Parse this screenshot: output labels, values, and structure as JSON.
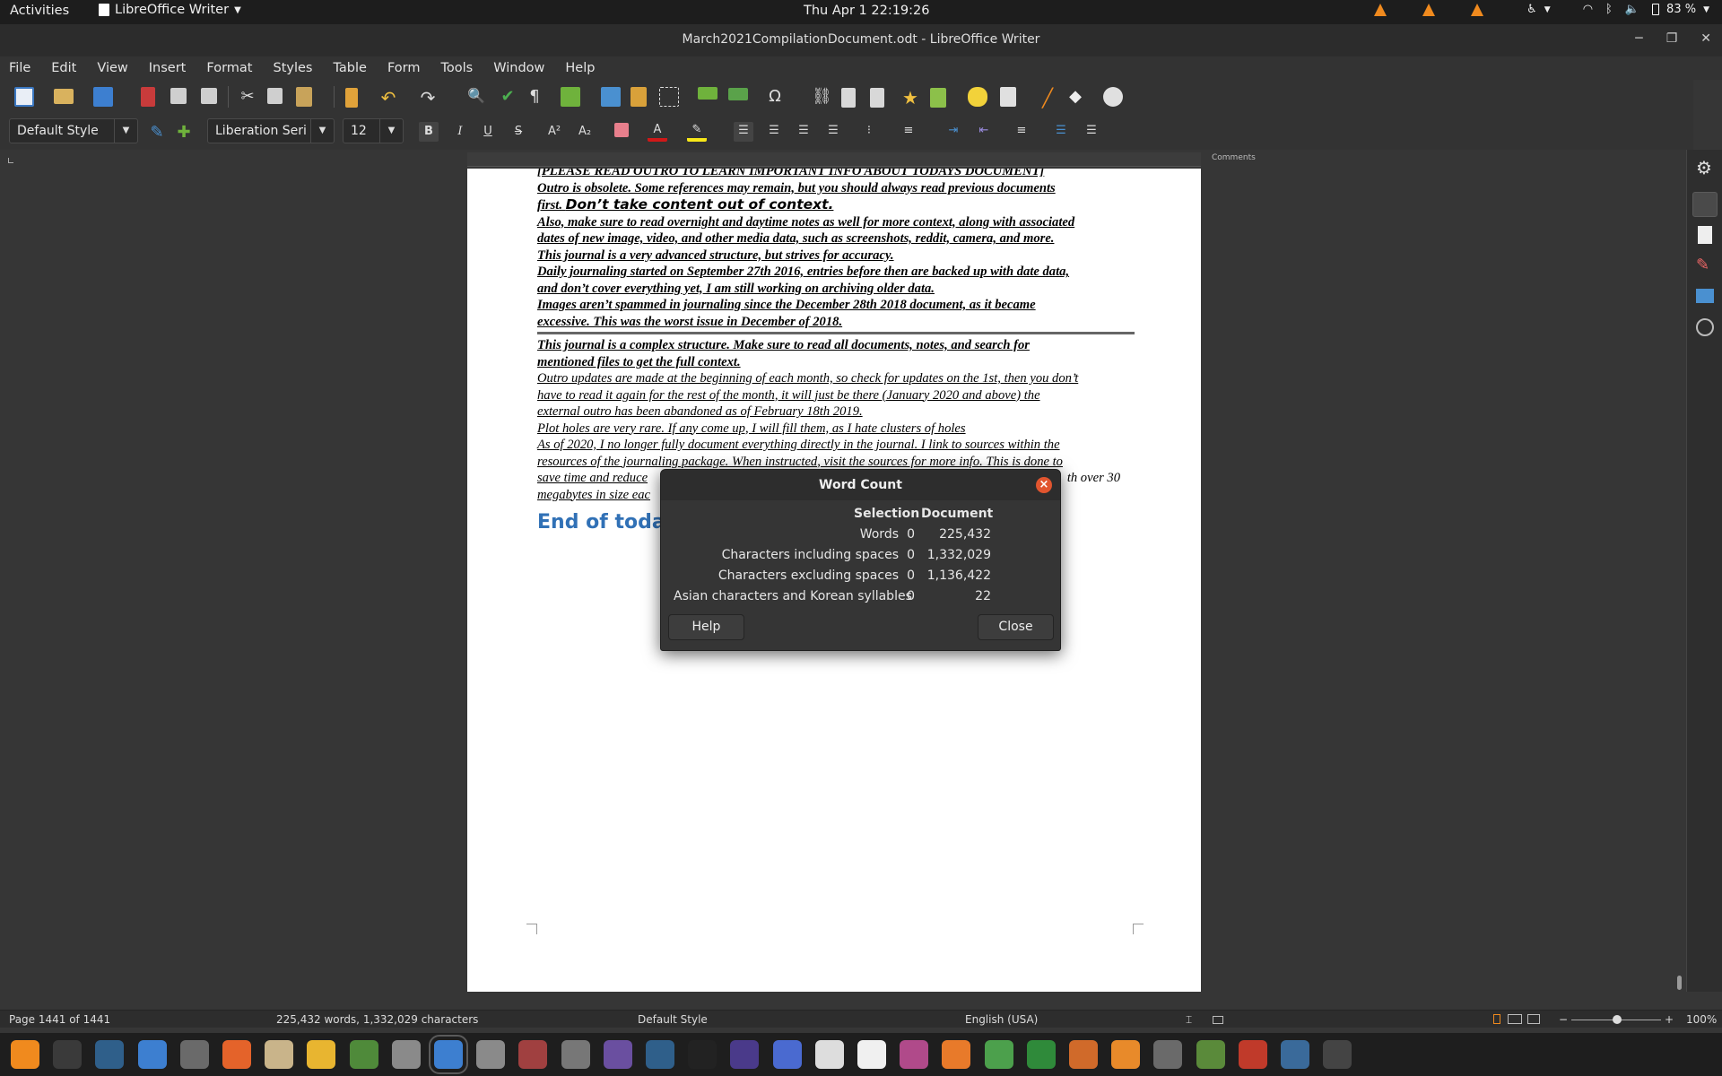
{
  "topbar": {
    "activities": "Activities",
    "app_menu": "LibreOffice Writer",
    "clock": "Thu Apr 1  22:19:26",
    "battery": "83 %"
  },
  "window": {
    "title": "March2021CompilationDocument.odt - LibreOffice Writer"
  },
  "menu": [
    "File",
    "Edit",
    "View",
    "Insert",
    "Format",
    "Styles",
    "Table",
    "Form",
    "Tools",
    "Window",
    "Help"
  ],
  "formatting": {
    "paragraph_style": "Default Style",
    "font_name": "Liberation Seri",
    "font_size": "12"
  },
  "ruler": {
    "comments_label": "Comments"
  },
  "document": {
    "lines": [
      {
        "text": "[PLEASE READ OUTRO TO LEARN IMPORTANT INFO ABOUT TODAYS DOCUMENT]",
        "bold": true
      },
      {
        "text": "Outro is obsolete. Some references may remain, but you should always read previous documents",
        "bold": true
      },
      {
        "text": "first.",
        "bold": true,
        "tail": "Don’t take content out of context."
      },
      {
        "text": "Also, make sure to read overnight and daytime notes as well for more context, along with associated",
        "bold": true
      },
      {
        "text": "dates of new image, video, and other media data, such as screenshots, reddit, camera, and more.",
        "bold": true
      },
      {
        "text": "This journal is a very advanced structure, but strives for accuracy.",
        "bold": true
      },
      {
        "text": "Daily journaling started on September 27th 2016, entries before then are backed up with date data,",
        "bold": true
      },
      {
        "text": "and don’t cover everything yet, I am still working on archiving older data.",
        "bold": true
      },
      {
        "text": "Images aren’t spammed in journaling since the December 28th 2018 document, as it became",
        "bold": true
      },
      {
        "text": "excessive. This was the worst issue in December of 2018.",
        "bold": true
      },
      {
        "text": "This journal is a complex structure. Make sure to read all documents, notes, and search for",
        "bold": true
      },
      {
        "text": "mentioned files to get the full context.",
        "bold": true
      },
      {
        "text": "Outro updates are made at the beginning of each month, so check for updates on the 1st, then you don’t",
        "bold": false
      },
      {
        "text": "have to read it again for the rest of the month, it will just be there (January 2020 and above) the",
        "bold": false
      },
      {
        "text": "external outro has been abandoned as of February 18th 2019.",
        "bold": false
      },
      {
        "text": "Plot holes are very rare. If any come up, I will fill them, as I hate clusters of holes",
        "bold": false
      },
      {
        "text": "As of 2020, I no longer fully document everything directly in the journal. I link to sources within the",
        "bold": false
      },
      {
        "text": "resources of the journaling package. When instructed, visit the sources for more info. This is done to",
        "bold": false
      },
      {
        "text": "save time and reduce",
        "bold": false,
        "right": "th over 30"
      },
      {
        "text": "megabytes in size eac",
        "bold": false
      }
    ],
    "heading": "End of toda"
  },
  "word_count_dialog": {
    "title": "Word Count",
    "col_selection": "Selection",
    "col_document": "Document",
    "rows": [
      {
        "label": "Words",
        "selection": "0",
        "document": "225,432"
      },
      {
        "label": "Characters including spaces",
        "selection": "0",
        "document": "1,332,029"
      },
      {
        "label": "Characters excluding spaces",
        "selection": "0",
        "document": "1,136,422"
      },
      {
        "label": "Asian characters and Korean syllables",
        "selection": "0",
        "document": "22"
      }
    ],
    "help_label": "Help",
    "close_label": "Close"
  },
  "statusbar": {
    "page": "Page 1441 of 1441",
    "counts": "225,432 words, 1,332,029 characters",
    "page_style": "Default Style",
    "language": "English (USA)",
    "zoom": "100%"
  },
  "dock_icons": [
    "vlc-icon",
    "terminal-icon",
    "system-monitor-icon",
    "text-editor-icon",
    "clock-icon",
    "firefox-icon",
    "files-icon",
    "calculator-icon",
    "puzzle-icon",
    "settings-icon",
    "writer-icon",
    "image-viewer-icon",
    "waveform-icon",
    "app-store-icon",
    "camera-icon",
    "virtualbox-icon",
    "inkscape-icon",
    "obs-icon",
    "screenshot-icon",
    "font-icon",
    "typora-icon",
    "tweaks-icon",
    "software-center-icon",
    "calc-icon",
    "spreadsheet-icon",
    "impress-icon",
    "blender-icon",
    "gimp-icon",
    "minecraft-icon",
    "mario-icon",
    "app-icon",
    "app-grid-icon"
  ],
  "colors": {
    "accent": "#3171b6",
    "close_button": "#e1552f",
    "panel": "#333333"
  }
}
